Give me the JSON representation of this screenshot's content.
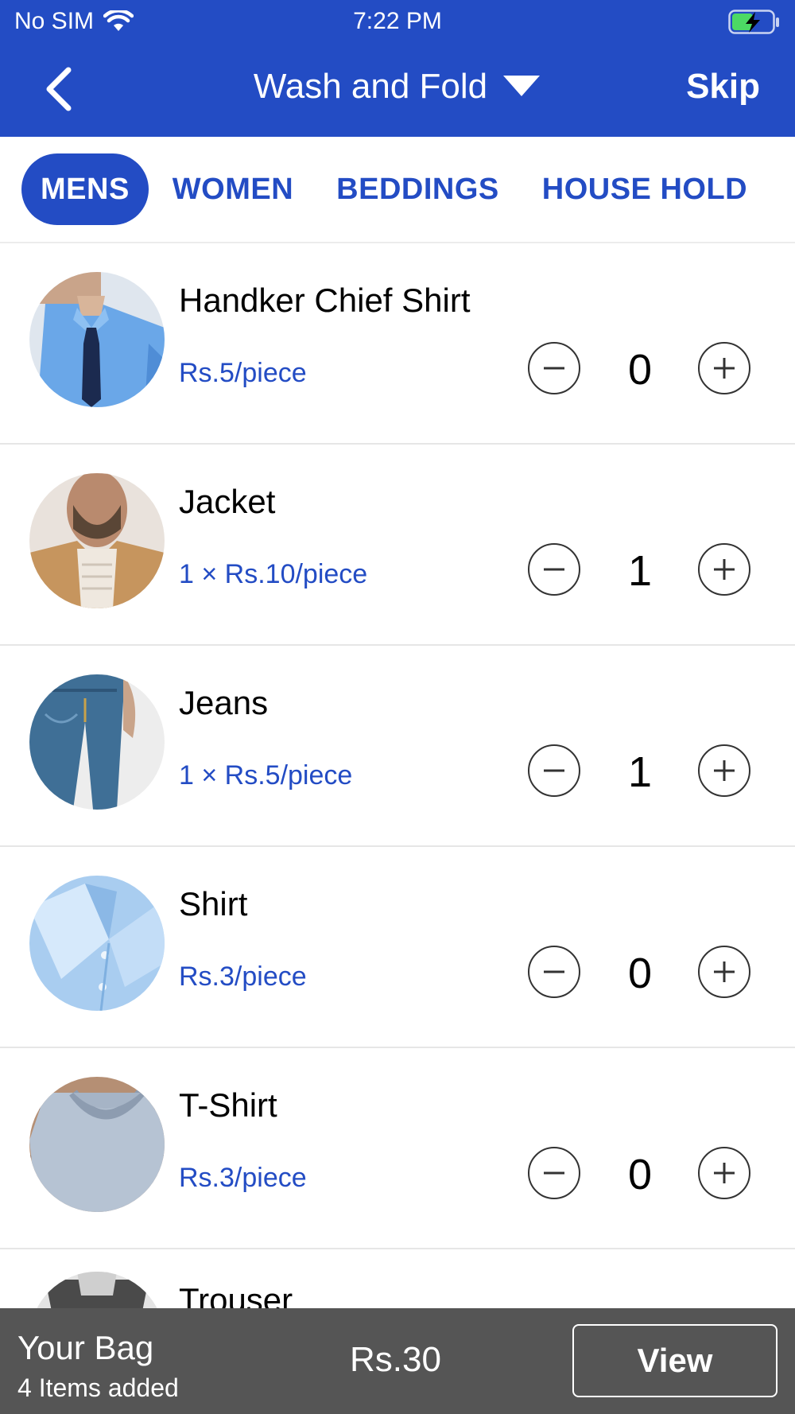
{
  "status_bar": {
    "carrier": "No SIM",
    "time": "7:22 PM",
    "wifi_icon": "wifi-icon",
    "battery_icon": "battery-charging-icon"
  },
  "nav": {
    "back_icon": "chevron-left-icon",
    "title": "Wash and Fold",
    "title_dropdown_icon": "triangle-down-icon",
    "skip_label": "Skip"
  },
  "tabs": [
    {
      "label": "MENS",
      "active": true
    },
    {
      "label": "WOMEN",
      "active": false
    },
    {
      "label": "BEDDINGS",
      "active": false
    },
    {
      "label": "HOUSE HOLD",
      "active": false
    }
  ],
  "items": [
    {
      "name": "Handker Chief Shirt",
      "price": "Rs.5/piece",
      "quantity": "0",
      "image": "shirt-and-tie-photo"
    },
    {
      "name": "Jacket",
      "price": "1 × Rs.10/piece",
      "quantity": "1",
      "image": "jacket-photo"
    },
    {
      "name": "Jeans",
      "price": "1 × Rs.5/piece",
      "quantity": "1",
      "image": "jeans-photo"
    },
    {
      "name": "Shirt",
      "price": "Rs.3/piece",
      "quantity": "0",
      "image": "shirt-collar-photo"
    },
    {
      "name": "T-Shirt",
      "price": "Rs.3/piece",
      "quantity": "0",
      "image": "tshirt-photo"
    },
    {
      "name": "Trouser",
      "image": "trouser-photo"
    }
  ],
  "bag": {
    "title": "Your Bag",
    "count": "4 Items added",
    "total": "Rs.30",
    "view_label": "View"
  },
  "colors": {
    "brand_blue": "#234cc4",
    "bag_bar": "#555555",
    "battery_green": "#4cd964"
  }
}
